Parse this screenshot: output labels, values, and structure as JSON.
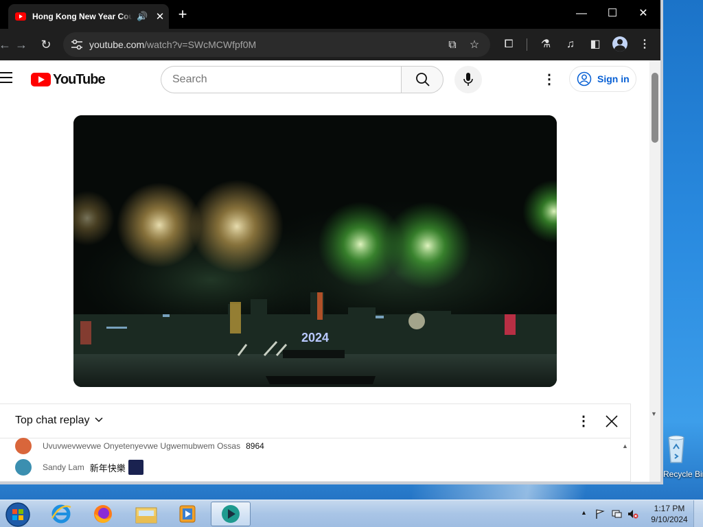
{
  "browser": {
    "tab": {
      "title": "Hong Kong New Year Countdown",
      "audio_icon": "speaker-icon",
      "close_label": "✕"
    },
    "new_tab_label": "+",
    "window_controls": {
      "minimize": "—",
      "maximize": "☐",
      "close": "✕"
    },
    "url_host": "youtube.com",
    "url_path": "/watch?v=SWcMCWfpf0M"
  },
  "youtube": {
    "logo_text": "YouTube",
    "search_placeholder": "Search",
    "sign_in_label": "Sign in"
  },
  "video": {
    "overlay_text": "2024"
  },
  "chat": {
    "title": "Top chat replay",
    "messages": [
      {
        "author": "Uvuvwevwevwe Onyetenyevwe Ugwemubwem Ossas",
        "text": "8964",
        "avatar_color": "#d9663b"
      },
      {
        "author": "Sandy Lam",
        "text": "新年快樂",
        "avatar_color": "#3b8fb0"
      }
    ]
  },
  "desktop": {
    "recycle_bin_label": "Recycle Bin"
  },
  "taskbar": {
    "apps": [
      "internet-explorer",
      "firefox",
      "file-explorer",
      "media-player",
      "active-app"
    ],
    "time": "1:17 PM",
    "date": "9/10/2024"
  },
  "colors": {
    "youtube_red": "#ff0000",
    "link_blue": "#065fd4",
    "chrome_dark": "#1f1f1f"
  }
}
